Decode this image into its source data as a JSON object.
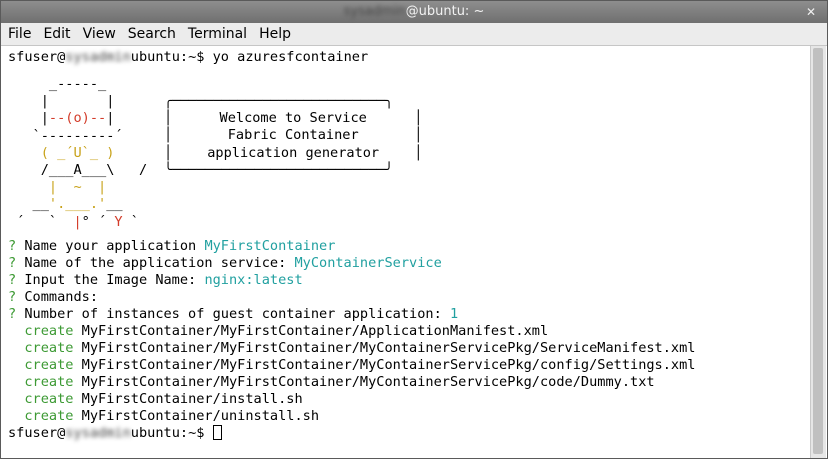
{
  "window": {
    "title_user": "sysadmin",
    "title_host": "@ubuntu: ~",
    "close_symbol": "✕"
  },
  "menu": [
    "File",
    "Edit",
    "View",
    "Search",
    "Terminal",
    "Help"
  ],
  "prompt": {
    "user": "sfuser@",
    "blurred": "sysadmin",
    "host": "ubuntu:~$ ",
    "command": "yo azuresfcontainer"
  },
  "banner": {
    "line1": "Welcome to Service",
    "line2": "Fabric Container",
    "line3": "application generator"
  },
  "questions": [
    {
      "mark": "?",
      "label": " Name your application ",
      "answer": "MyFirstContainer"
    },
    {
      "mark": "?",
      "label": " Name of the application service: ",
      "answer": "MyContainerService"
    },
    {
      "mark": "?",
      "label": " Input the Image Name: ",
      "answer": "nginx:latest"
    },
    {
      "mark": "?",
      "label": " Commands:",
      "answer": ""
    },
    {
      "mark": "?",
      "label": " Number of instances of guest container application: ",
      "answer": "1"
    }
  ],
  "created": [
    {
      "verb": "create",
      "path": "MyFirstContainer/MyFirstContainer/ApplicationManifest.xml"
    },
    {
      "verb": "create",
      "path": "MyFirstContainer/MyFirstContainer/MyContainerServicePkg/ServiceManifest.xml"
    },
    {
      "verb": "create",
      "path": "MyFirstContainer/MyFirstContainer/MyContainerServicePkg/config/Settings.xml"
    },
    {
      "verb": "create",
      "path": "MyFirstContainer/MyFirstContainer/MyContainerServicePkg/code/Dummy.txt"
    },
    {
      "verb": "create",
      "path": "MyFirstContainer/install.sh"
    },
    {
      "verb": "create",
      "path": "MyFirstContainer/uninstall.sh"
    }
  ],
  "final_prompt": {
    "user": "sfuser@",
    "blurred": "sysadmin",
    "host": "ubuntu:~$ "
  }
}
